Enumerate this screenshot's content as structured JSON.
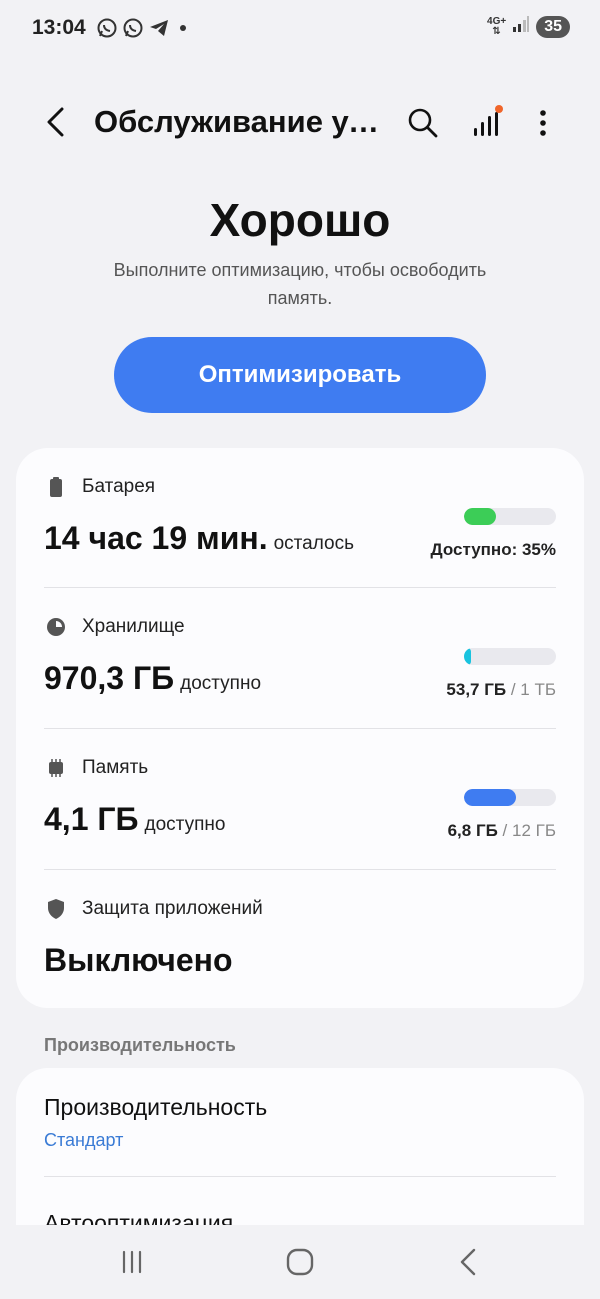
{
  "status_bar": {
    "time": "13:04",
    "network": "4G+",
    "battery": "35",
    "notification_icons": [
      "whatsapp-icon",
      "whatsapp-icon",
      "telegram-icon",
      "dot-icon"
    ]
  },
  "app_bar": {
    "title": "Обслуживание устройства",
    "icons": [
      "back-arrow-icon",
      "search-icon",
      "signal-bars-icon",
      "more-vert-icon"
    ]
  },
  "header": {
    "status": "Хорошо",
    "description": "Выполните оптимизацию, чтобы освободить память.",
    "optimize_button": "Оптимизировать"
  },
  "items": {
    "battery": {
      "label": "Батарея",
      "value": "14 час 19 мин.",
      "suffix": "осталось",
      "stat": "Доступно: 35%",
      "level": 0.35,
      "color": "#3ccd57"
    },
    "storage": {
      "label": "Хранилище",
      "value": "970,3 ГБ",
      "suffix": "доступно",
      "stat_used": "53,7 ГБ",
      "stat_total": "/ 1 ТБ",
      "level": 0.054,
      "color": "#19c3df"
    },
    "memory": {
      "label": "Память",
      "value": "4,1 ГБ",
      "suffix": "доступно",
      "stat_used": "6,8 ГБ",
      "stat_total": "/ 12 ГБ",
      "level": 0.57,
      "color": "#3f7cf1"
    },
    "app_protection": {
      "label": "Защита приложений",
      "value": "Выключено"
    }
  },
  "performance_section": {
    "header": "Производительность",
    "performance_title": "Производительность",
    "performance_value": "Стандарт",
    "auto_optimize_title": "Автооптимизация"
  },
  "nav_bar": {
    "icons": [
      "recent-apps-icon",
      "home-icon",
      "back-icon"
    ]
  }
}
